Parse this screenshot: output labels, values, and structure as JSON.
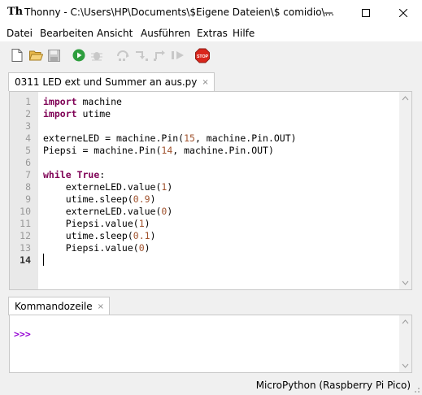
{
  "window": {
    "app_name": "Thonny",
    "title": "Thonny  -  C:\\Users\\HP\\Documents\\$Eigene Dateien\\$ comidio\\...",
    "minimize": "—",
    "maximize": "☐",
    "close": "✕"
  },
  "menu": [
    "Datei",
    "Bearbeiten",
    "Ansicht",
    "Ausführen",
    "Extras",
    "Hilfe"
  ],
  "toolbar": {
    "icons": [
      "new-file-icon",
      "open-folder-icon",
      "save-icon",
      "run-icon",
      "debug-icon",
      "step-over-icon",
      "step-into-icon",
      "step-out-icon",
      "resume-icon",
      "stop-icon"
    ],
    "stop_label": "STOP"
  },
  "editor": {
    "tab_title": "0311 LED ext und Summer an aus.py",
    "tab_close": "×",
    "line_numbers": [
      "1",
      "2",
      "3",
      "4",
      "5",
      "6",
      "7",
      "8",
      "9",
      "10",
      "11",
      "12",
      "13",
      "14"
    ],
    "current_line": 14,
    "lines": [
      "import machine",
      "import utime",
      "",
      "externeLED = machine.Pin(15, machine.Pin.OUT)",
      "Piepsi = machine.Pin(14, machine.Pin.OUT)",
      "",
      "while True:",
      "    externeLED.value(1)",
      "    utime.sleep(0.9)",
      "    externeLED.value(0)",
      "    Piepsi.value(1)",
      "    utime.sleep(0.1)",
      "    Piepsi.value(0)",
      ""
    ]
  },
  "shell": {
    "tab_title": "Kommandozeile",
    "tab_close": "×",
    "prompt": ">>>"
  },
  "status": {
    "interpreter": "MicroPython (Raspberry Pi Pico)"
  },
  "colors": {
    "keyword": "#7f0055",
    "number": "#a0522d",
    "prompt": "#9400d3",
    "run_green": "#2e9e3e",
    "stop_red": "#d9261c"
  }
}
